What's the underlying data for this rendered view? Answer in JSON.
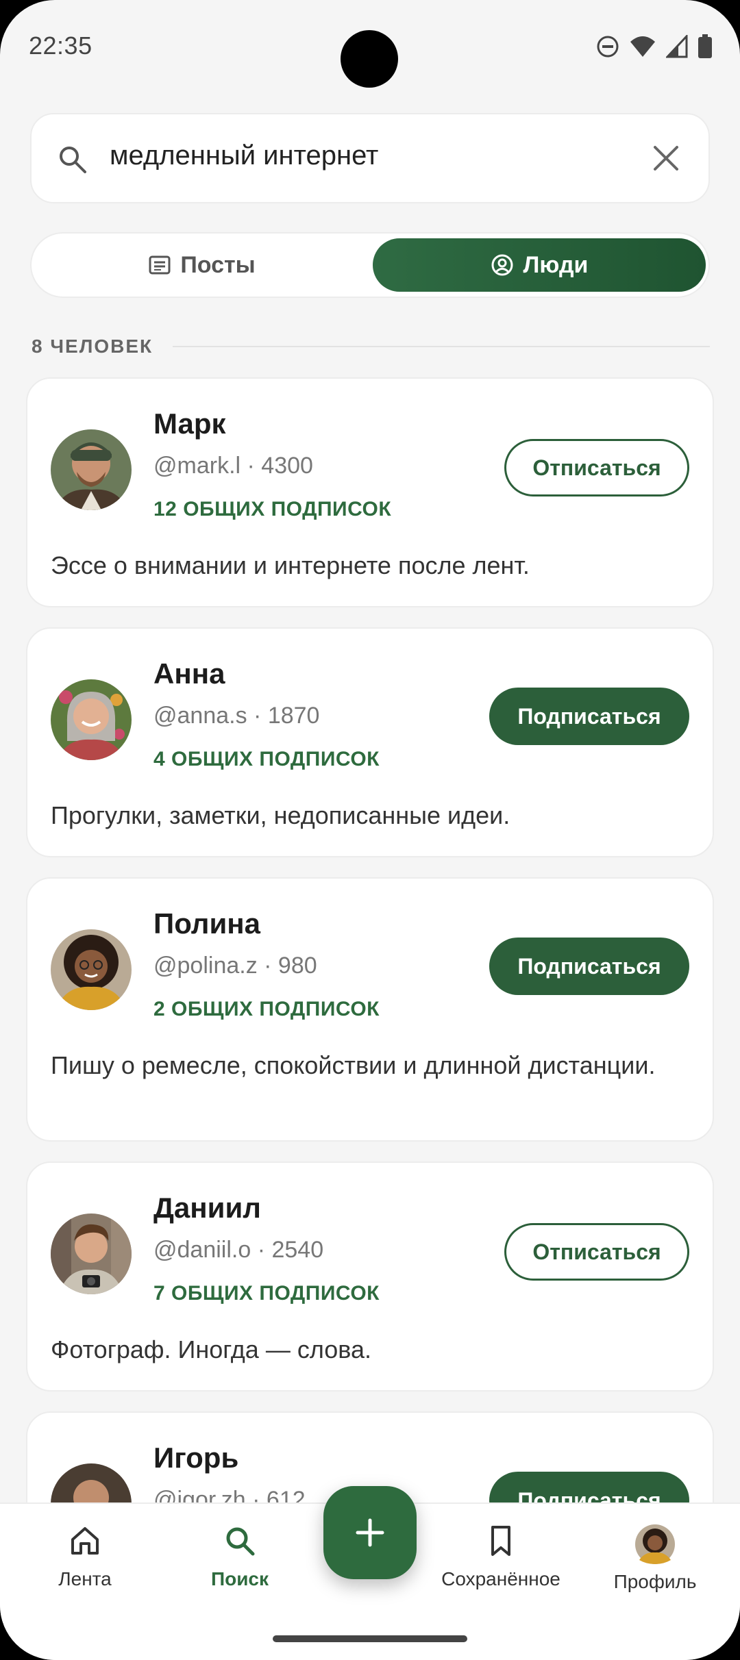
{
  "status_bar": {
    "time": "22:35"
  },
  "search": {
    "query": "медленный интернет"
  },
  "tabs": {
    "posts": "Посты",
    "people": "Люди",
    "active": "people"
  },
  "results": {
    "count_label": "8 ЧЕЛОВЕК",
    "people": [
      {
        "name": "Марк",
        "handle": "@mark.l · 4300",
        "mutual": "12 ОБЩИХ ПОДПИСОК",
        "bio": "Эссе о внимании и интернете после лент.",
        "button": "Отписаться",
        "following": true
      },
      {
        "name": "Анна",
        "handle": "@anna.s · 1870",
        "mutual": "4 ОБЩИХ ПОДПИСОК",
        "bio": "Прогулки, заметки, недописанные идеи.",
        "button": "Подписаться",
        "following": false
      },
      {
        "name": "Полина",
        "handle": "@polina.z · 980",
        "mutual": "2 ОБЩИХ ПОДПИСОК",
        "bio": "Пишу о ремесле, спокойствии и длинной дистанции.",
        "button": "Подписаться",
        "following": false
      },
      {
        "name": "Даниил",
        "handle": "@daniil.o · 2540",
        "mutual": "7 ОБЩИХ ПОДПИСОК",
        "bio": "Фотограф. Иногда — слова.",
        "button": "Отписаться",
        "following": true
      },
      {
        "name": "Игорь",
        "handle": "@igor.zh · 612",
        "mutual": "",
        "bio": "",
        "button": "Подписаться",
        "following": false
      }
    ]
  },
  "bottom_nav": {
    "feed": "Лента",
    "search": "Поиск",
    "saved": "Сохранённое",
    "profile": "Профиль",
    "active": "search"
  },
  "colors": {
    "accent": "#2e6b3e",
    "background": "#f5f5f5"
  }
}
